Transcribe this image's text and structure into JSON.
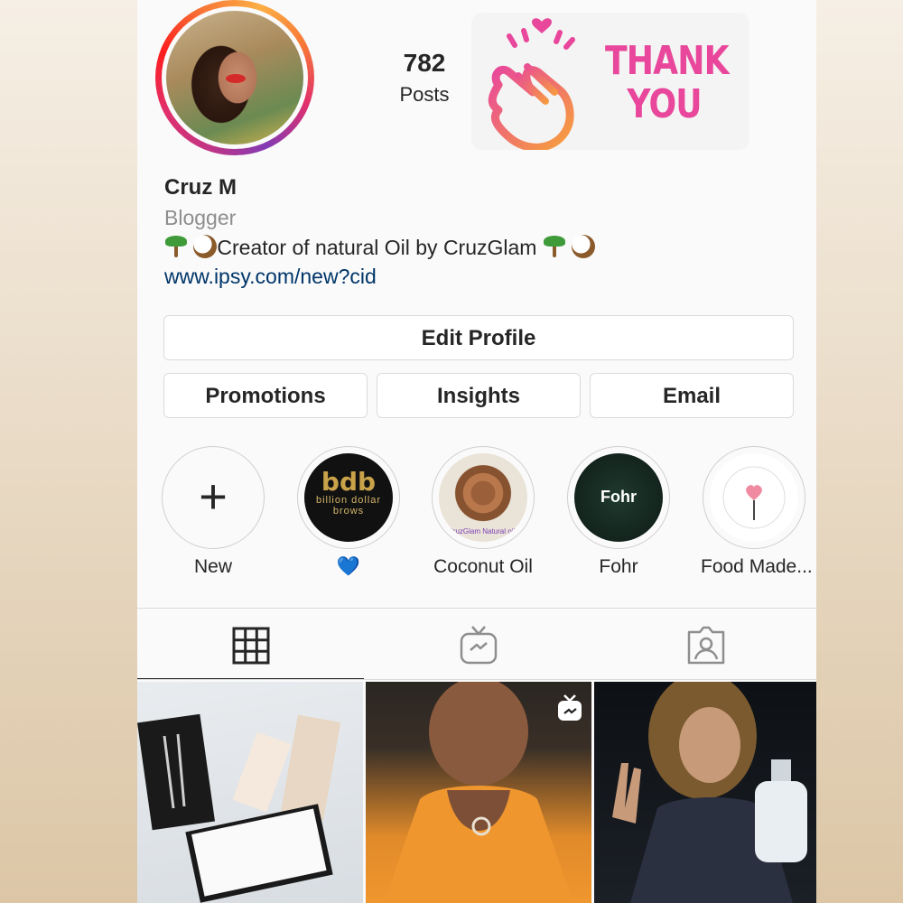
{
  "profile": {
    "posts_count": "782",
    "posts_label": "Posts",
    "name": "Cruz M",
    "category": "Blogger",
    "bio_text": "Creator of natural Oil by CruzGlam",
    "website": "www.ipsy.com/new?cid",
    "sticker_text": "THANK YOU"
  },
  "buttons": {
    "edit_profile": "Edit Profile",
    "promotions": "Promotions",
    "insights": "Insights",
    "email": "Email"
  },
  "highlights": [
    {
      "label": "New",
      "icon": "plus-icon"
    },
    {
      "label": "💙",
      "cover_text": "bdb",
      "cover_sub": "billion dollar brows"
    },
    {
      "label": "Coconut Oil"
    },
    {
      "label": "Fohr",
      "cover_text": "Fohr"
    },
    {
      "label": "Food Made..."
    }
  ],
  "tabs": [
    {
      "icon": "grid-icon",
      "active": true
    },
    {
      "icon": "igtv-icon",
      "active": false
    },
    {
      "icon": "tagged-icon",
      "active": false
    }
  ],
  "colors": {
    "link": "#003569",
    "sticker_pink": "#e8479b",
    "muted": "#8e8e8e"
  }
}
